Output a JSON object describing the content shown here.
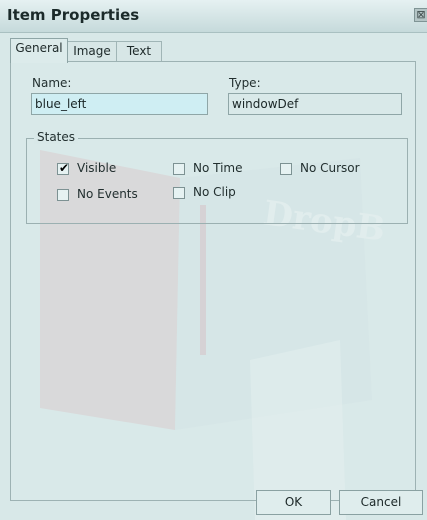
{
  "window": {
    "title": "Item Properties",
    "close_glyph": "⊠"
  },
  "tabs": [
    {
      "label": "General",
      "active": true
    },
    {
      "label": "Image",
      "active": false
    },
    {
      "label": "Text",
      "active": false
    }
  ],
  "general": {
    "name_label": "Name:",
    "name_value": "blue_left",
    "type_label": "Type:",
    "type_value": "windowDef",
    "states": {
      "legend": "States",
      "checkboxes": [
        {
          "label": "Visible",
          "checked": true
        },
        {
          "label": "No Time",
          "checked": false
        },
        {
          "label": "No Cursor",
          "checked": false
        },
        {
          "label": "No Events",
          "checked": false
        },
        {
          "label": "No Clip",
          "checked": false
        }
      ]
    }
  },
  "buttons": {
    "ok_label": "OK",
    "cancel_label": "Cancel"
  },
  "watermark": {
    "text": "DropB"
  },
  "colors": {
    "background": "#d8e8e8",
    "name_field_bg": "#cfeef3",
    "watermark_red": "#d9b8bb",
    "watermark_book": "#e9f2f2"
  },
  "icons": {
    "close": "close-icon",
    "check": "checkmark-icon"
  }
}
